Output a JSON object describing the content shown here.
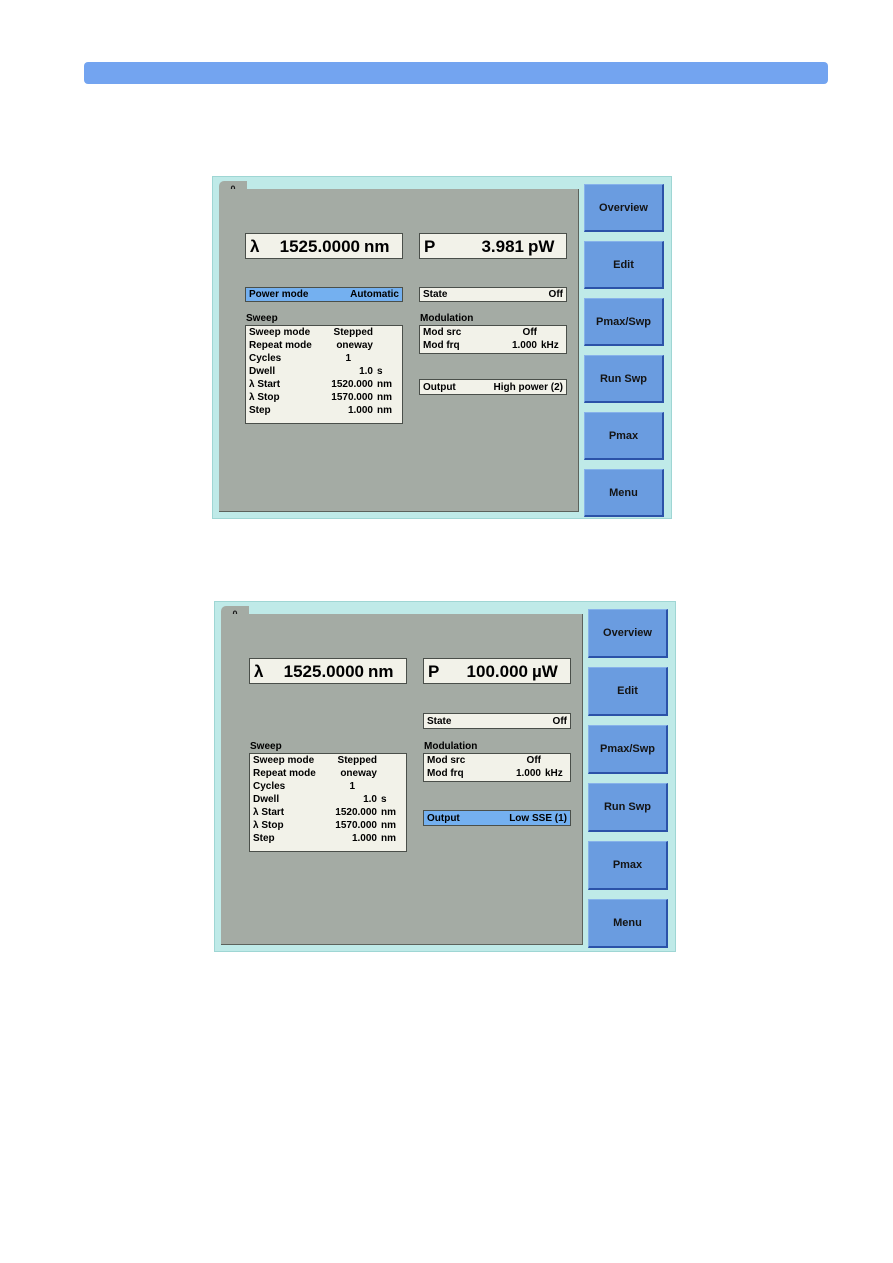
{
  "page": {
    "banner_color": "#73a4f0",
    "screen_bg_color": "#bfeae8",
    "display_bg_color": "#a4aba4",
    "field_bg_color": "#f2f2e9",
    "highlight_color": "#74b0f0",
    "softkey_color": "#6a9ce0"
  },
  "screens": [
    {
      "tab_label": "0",
      "wavelength": {
        "label": "λ",
        "value": "1525.0000",
        "unit": "nm"
      },
      "power": {
        "label": "P",
        "value": "3.981",
        "unit": "pW"
      },
      "power_mode": {
        "label": "Power mode",
        "value": "Automatic",
        "highlighted": true
      },
      "state": {
        "label": "State",
        "value": "Off",
        "highlighted": false
      },
      "sweep_title": "Sweep",
      "sweep_rows": [
        {
          "key": "Sweep mode",
          "value": "Stepped",
          "unit": ""
        },
        {
          "key": "Repeat mode",
          "value": "oneway",
          "unit": ""
        },
        {
          "key": "Cycles",
          "value": "1",
          "unit": ""
        },
        {
          "key": "Dwell",
          "value": "1.0",
          "unit": "s"
        },
        {
          "key": "λ Start",
          "value": "1520.000",
          "unit": "nm"
        },
        {
          "key": "λ Stop",
          "value": "1570.000",
          "unit": "nm"
        },
        {
          "key": "Step",
          "value": "1.000",
          "unit": "nm"
        }
      ],
      "modulation_title": "Modulation",
      "modulation_rows": [
        {
          "key": "Mod src",
          "value": "Off",
          "unit": ""
        },
        {
          "key": "Mod frq",
          "value": "1.000",
          "unit": "kHz"
        }
      ],
      "output": {
        "label": "Output",
        "value": "High power (2)",
        "highlighted": false
      },
      "softkeys": [
        "Overview",
        "Edit",
        "Pmax/Swp",
        "Run Swp",
        "Pmax",
        "Menu"
      ]
    },
    {
      "tab_label": "0",
      "wavelength": {
        "label": "λ",
        "value": "1525.0000",
        "unit": "nm"
      },
      "power": {
        "label": "P",
        "value": "100.000",
        "unit": "µW"
      },
      "power_mode": null,
      "state": {
        "label": "State",
        "value": "Off",
        "highlighted": false
      },
      "sweep_title": "Sweep",
      "sweep_rows": [
        {
          "key": "Sweep mode",
          "value": "Stepped",
          "unit": ""
        },
        {
          "key": "Repeat mode",
          "value": "oneway",
          "unit": ""
        },
        {
          "key": "Cycles",
          "value": "1",
          "unit": ""
        },
        {
          "key": "Dwell",
          "value": "1.0",
          "unit": "s"
        },
        {
          "key": "λ Start",
          "value": "1520.000",
          "unit": "nm"
        },
        {
          "key": "λ Stop",
          "value": "1570.000",
          "unit": "nm"
        },
        {
          "key": "Step",
          "value": "1.000",
          "unit": "nm"
        }
      ],
      "modulation_title": "Modulation",
      "modulation_rows": [
        {
          "key": "Mod src",
          "value": "Off",
          "unit": ""
        },
        {
          "key": "Mod frq",
          "value": "1.000",
          "unit": "kHz"
        }
      ],
      "output": {
        "label": "Output",
        "value": "Low SSE (1)",
        "highlighted": true
      },
      "softkeys": [
        "Overview",
        "Edit",
        "Pmax/Swp",
        "Run Swp",
        "Pmax",
        "Menu"
      ]
    }
  ]
}
